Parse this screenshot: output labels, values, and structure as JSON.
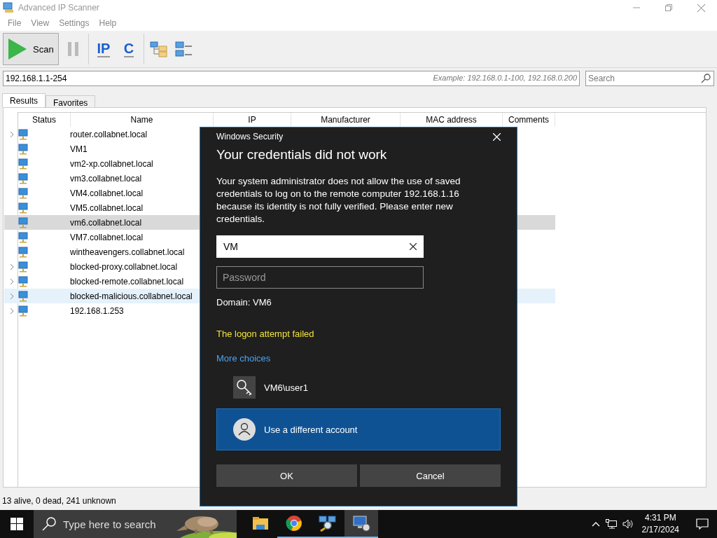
{
  "window": {
    "title": "Advanced IP Scanner"
  },
  "menu": [
    "File",
    "View",
    "Settings",
    "Help"
  ],
  "toolbar": {
    "scan_label": "Scan",
    "tools": [
      {
        "kind": "pause"
      },
      {
        "kind": "letters",
        "label": "IP"
      },
      {
        "kind": "letters",
        "label": "C"
      },
      {
        "kind": "tree"
      },
      {
        "kind": "list"
      }
    ]
  },
  "range": {
    "value": "192.168.1.1-254",
    "hint": "Example: 192.168.0.1-100, 192.168.0.200"
  },
  "search": {
    "placeholder": "Search"
  },
  "tabs": [
    {
      "label": "Results",
      "selected": true
    },
    {
      "label": "Favorites",
      "selected": false
    }
  ],
  "table": {
    "columns": [
      "Status",
      "Name",
      "IP",
      "Manufacturer",
      "MAC address",
      "Comments"
    ],
    "rows": [
      {
        "name": "router.collabnet.local",
        "expandable": true,
        "selected": false,
        "hovered": false
      },
      {
        "name": "VM1",
        "expandable": false,
        "selected": false,
        "hovered": false
      },
      {
        "name": "vm2-xp.collabnet.local",
        "expandable": false,
        "selected": false,
        "hovered": false
      },
      {
        "name": "vm3.collabnet.local",
        "expandable": false,
        "selected": false,
        "hovered": false
      },
      {
        "name": "VM4.collabnet.local",
        "expandable": false,
        "selected": false,
        "hovered": false
      },
      {
        "name": "VM5.collabnet.local",
        "expandable": false,
        "selected": false,
        "hovered": false
      },
      {
        "name": "vm6.collabnet.local",
        "expandable": false,
        "selected": true,
        "hovered": false
      },
      {
        "name": "VM7.collabnet.local",
        "expandable": false,
        "selected": false,
        "hovered": false
      },
      {
        "name": "wintheavengers.collabnet.local",
        "expandable": false,
        "selected": false,
        "hovered": false
      },
      {
        "name": "blocked-proxy.collabnet.local",
        "expandable": true,
        "selected": false,
        "hovered": false
      },
      {
        "name": "blocked-remote.collabnet.local",
        "expandable": true,
        "selected": false,
        "hovered": false
      },
      {
        "name": "blocked-malicious.collabnet.local",
        "expandable": true,
        "selected": false,
        "hovered": true
      },
      {
        "name": "192.168.1.253",
        "expandable": true,
        "selected": false,
        "hovered": false
      }
    ]
  },
  "status_bar": "13 alive, 0 dead, 241 unknown",
  "dialog": {
    "title": "Windows Security",
    "heading": "Your credentials did not work",
    "message": "Your system administrator does not allow the use of saved credentials to log on to the remote computer 192.168.1.16 because its identity is not fully verified. Please enter new credentials.",
    "username": {
      "value": "VM"
    },
    "password": {
      "placeholder": "Password"
    },
    "domain": "Domain: VM6",
    "error": "The logon attempt failed",
    "more_choices": "More choices",
    "accounts": [
      {
        "kind": "key",
        "label": "VM6\\user1",
        "selected": false
      },
      {
        "kind": "person",
        "label": "Use a different account",
        "selected": true
      }
    ],
    "buttons": [
      "OK",
      "Cancel"
    ]
  },
  "taskbar": {
    "search_placeholder": "Type here to search",
    "apps": [
      {
        "kind": "folder",
        "running": false,
        "active": false
      },
      {
        "kind": "browser",
        "running": true,
        "active": false
      },
      {
        "kind": "scanner",
        "running": true,
        "active": false
      },
      {
        "kind": "remote",
        "running": true,
        "active": true
      }
    ],
    "time": "4:31 PM",
    "date": "2/17/2024"
  }
}
